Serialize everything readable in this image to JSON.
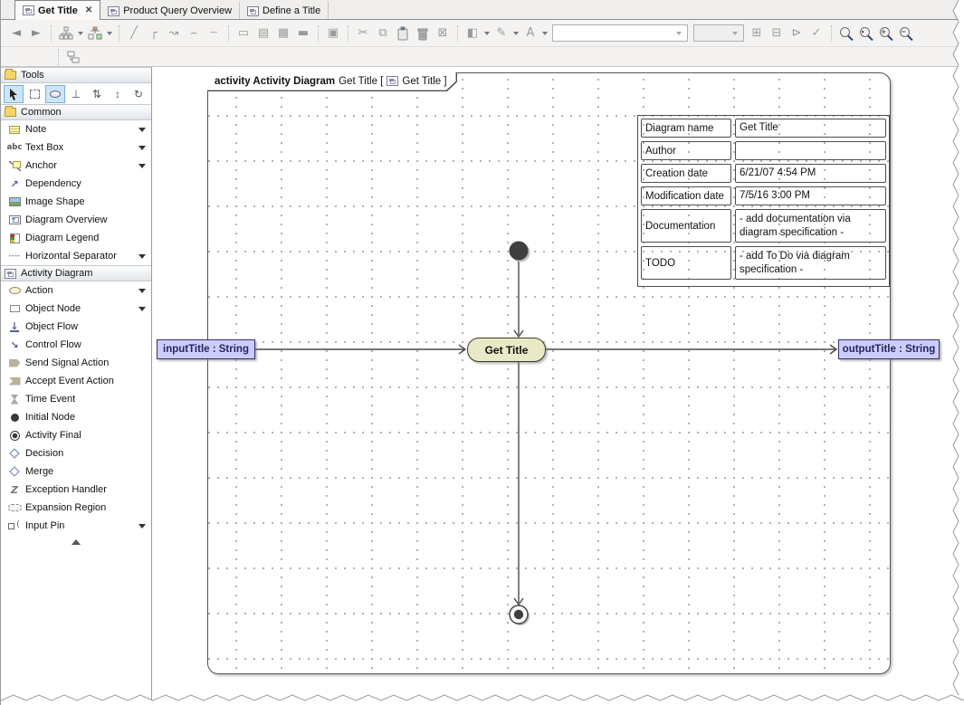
{
  "tabs": [
    {
      "label": "Get Title",
      "active": true
    },
    {
      "label": "Product Query Overview",
      "active": false
    },
    {
      "label": "Define a Title",
      "active": false
    }
  ],
  "icons": {
    "close": "✕"
  },
  "toolbar": {
    "glyphs": {
      "back": "◄",
      "forward": "►",
      "line_straight": "╱",
      "line_rect": "┌",
      "line_oblique": "↝",
      "line_curve": "⌢",
      "line_dashed": "┄",
      "related": "▭",
      "paths": "▤",
      "box1": "▦",
      "box2": "▬",
      "box3": "▣",
      "cut": "✂",
      "copy": "⧉",
      "delete": "⊠",
      "fill": "◧",
      "pen": "✎",
      "font": "A",
      "front": "⊞",
      "backward": "⊟",
      "select_sym": "⊳",
      "apply": "✓",
      "zoom_in": "+",
      "zoom_out": "−"
    },
    "style_combo_value": "",
    "zoom_combo_value": ""
  },
  "sidebar": {
    "tools_header": "Tools",
    "common_header": "Common",
    "activity_header": "Activity Diagram",
    "icons": {
      "text_box": "abc",
      "separator": "----",
      "stamp": "⊥",
      "distribute": "⇅",
      "updown": "↕",
      "swap": "↻",
      "dependency": "↗",
      "object_flow": "↓",
      "control_flow": "↘",
      "exception": "Z"
    },
    "common_items": [
      {
        "label": "Note",
        "dropdown": true
      },
      {
        "label": "Text Box",
        "dropdown": true
      },
      {
        "label": "Anchor",
        "dropdown": true
      },
      {
        "label": "Dependency",
        "dropdown": false
      },
      {
        "label": "Image Shape",
        "dropdown": false
      },
      {
        "label": "Diagram Overview",
        "dropdown": false
      },
      {
        "label": "Diagram Legend",
        "dropdown": false
      },
      {
        "label": "Horizontal Separator",
        "dropdown": true
      }
    ],
    "activity_items": [
      {
        "label": "Action",
        "dropdown": true
      },
      {
        "label": "Object Node",
        "dropdown": true
      },
      {
        "label": "Object Flow",
        "dropdown": false
      },
      {
        "label": "Control Flow",
        "dropdown": false
      },
      {
        "label": "Send Signal Action",
        "dropdown": false
      },
      {
        "label": "Accept Event Action",
        "dropdown": false
      },
      {
        "label": "Time Event",
        "dropdown": false
      },
      {
        "label": "Initial Node",
        "dropdown": false
      },
      {
        "label": "Activity Final",
        "dropdown": false
      },
      {
        "label": "Decision",
        "dropdown": false
      },
      {
        "label": "Merge",
        "dropdown": false
      },
      {
        "label": "Exception Handler",
        "dropdown": false
      },
      {
        "label": "Expansion Region",
        "dropdown": false
      },
      {
        "label": "Input Pin",
        "dropdown": true
      }
    ]
  },
  "diagram": {
    "frame_label_keyword": "activity Activity Diagram",
    "frame_label_name": "Get Title [",
    "frame_label_ref": "Get Title ]",
    "action_node_label": "Get Title",
    "input_param_label": "inputTitle : String",
    "output_param_label": "outputTitle : String",
    "info_table_rows": [
      {
        "key": "Diagram name",
        "value": "Get Title"
      },
      {
        "key": "Author",
        "value": ""
      },
      {
        "key": "Creation date",
        "value": "6/21/07 4:54 PM"
      },
      {
        "key": "Modification date",
        "value": "7/5/16 3:00 PM"
      },
      {
        "key": "Documentation",
        "value": "- add documentation via diagram specification -"
      },
      {
        "key": "TODO",
        "value": "- add To Do via diagram specification -"
      }
    ]
  },
  "colors": {
    "param_fill": "#ccccfe",
    "action_fill": "#e9e9c7",
    "selection_blue": "#cde6f7",
    "flow_line": "#4a4a4a"
  }
}
